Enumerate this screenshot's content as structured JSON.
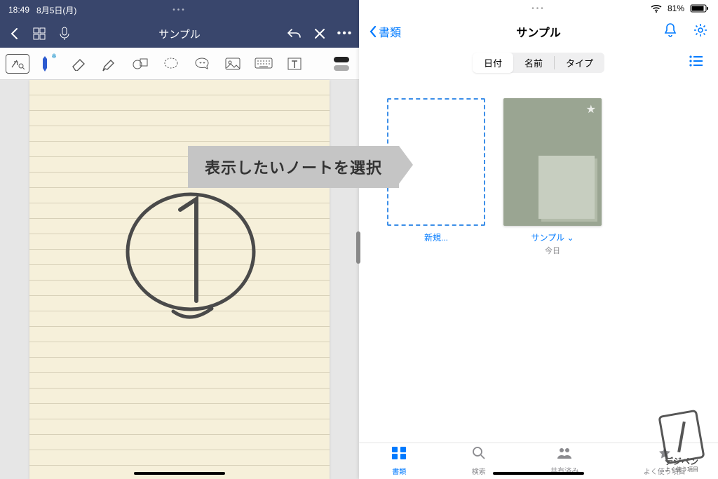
{
  "left": {
    "status": {
      "time": "18:49",
      "date": "8月5日(月)"
    },
    "title": "サンプル"
  },
  "right": {
    "status": {
      "battery": "81%"
    },
    "back_label": "書類",
    "title": "サンプル",
    "segments": {
      "date": "日付",
      "name": "名前",
      "type": "タイプ"
    },
    "tiles": {
      "new_label": "新規...",
      "note_name": "サンプル ⌄",
      "note_sub": "今日"
    },
    "tabs": {
      "documents": "書類",
      "search": "検索",
      "shared": "共有済み",
      "favorites": "よく使う項目"
    }
  },
  "callout": "表示したいノートを選択",
  "watermark": {
    "brand": "デジペン",
    "sub": "よく使う項目"
  }
}
